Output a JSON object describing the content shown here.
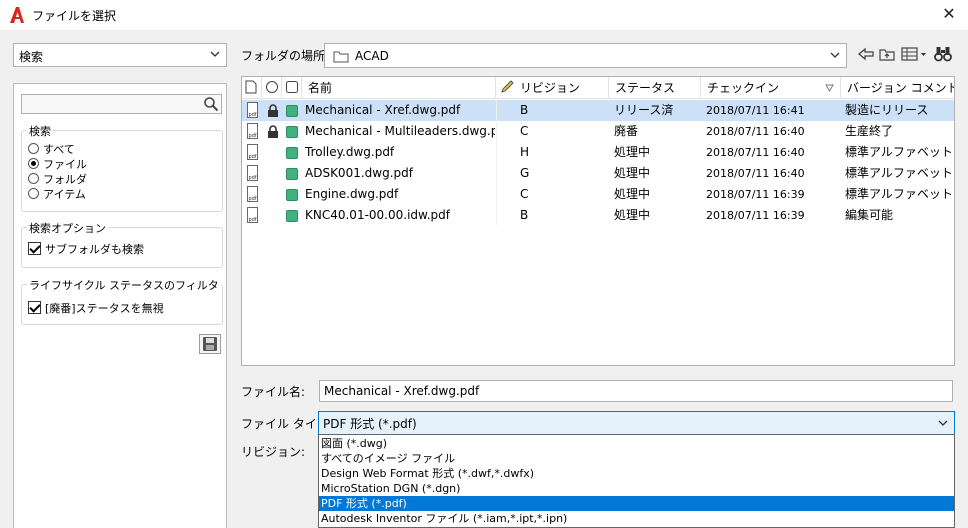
{
  "window": {
    "title": "ファイルを選択",
    "close_glyph": "✕"
  },
  "left": {
    "search_mode": "検索",
    "search_group_label": "検索",
    "radio_options": [
      {
        "label": "すべて",
        "selected": false
      },
      {
        "label": "ファイル",
        "selected": true
      },
      {
        "label": "フォルダ",
        "selected": false
      },
      {
        "label": "アイテム",
        "selected": false
      }
    ],
    "options_group_label": "検索オプション",
    "subfolder_label": "サブフォルダも検索",
    "subfolder_checked": true,
    "lifecycle_group_label": "ライフサイクル ステータスのフィルタ",
    "ignore_obsolete_label": "[廃番]ステータスを無視",
    "ignore_obsolete_checked": true
  },
  "folder": {
    "label": "フォルダの場所:",
    "value": "ACAD"
  },
  "table": {
    "headers": {
      "name": "名前",
      "revision": "リビジョン",
      "status": "ステータス",
      "checkin": "チェックイン",
      "version_comment": "バージョン コメント"
    },
    "rows": [
      {
        "name": "Mechanical - Xref.dwg.pdf",
        "revision": "B",
        "status": "リリース済",
        "checkin": "2018/07/11 16:41",
        "comment": "製造にリリース",
        "locked": true,
        "selected": true
      },
      {
        "name": "Mechanical - Multileaders.dwg.pdf",
        "revision": "C",
        "status": "廃番",
        "checkin": "2018/07/11 16:40",
        "comment": "生産終了",
        "locked": true,
        "selected": false
      },
      {
        "name": "Trolley.dwg.pdf",
        "revision": "H",
        "status": "処理中",
        "checkin": "2018/07/11 16:40",
        "comment": "標準アルファベット フ...",
        "locked": false,
        "selected": false
      },
      {
        "name": "ADSK001.dwg.pdf",
        "revision": "G",
        "status": "処理中",
        "checkin": "2018/07/11 16:40",
        "comment": "標準アルファベット フ...",
        "locked": false,
        "selected": false
      },
      {
        "name": "Engine.dwg.pdf",
        "revision": "C",
        "status": "処理中",
        "checkin": "2018/07/11 16:39",
        "comment": "標準アルファベット フ...",
        "locked": false,
        "selected": false
      },
      {
        "name": "KNC40.01-00.00.idw.pdf",
        "revision": "B",
        "status": "処理中",
        "checkin": "2018/07/11 16:39",
        "comment": "編集可能",
        "locked": false,
        "selected": false
      }
    ]
  },
  "bottom": {
    "filename_label": "ファイル名:",
    "filename_value": "Mechanical - Xref.dwg.pdf",
    "filetype_label": "ファイル タイプ:",
    "filetype_value": "PDF 形式 (*.pdf)",
    "revision_label": "リビジョン:",
    "filetype_options": [
      "図面 (*.dwg)",
      "すべてのイメージ ファイル",
      "Design Web Format 形式 (*.dwf,*.dwfx)",
      "MicroStation DGN (*.dgn)",
      "PDF 形式 (*.pdf)",
      "Autodesk Inventor ファイル (*.iam,*.ipt,*.ipn)"
    ],
    "filetype_selected_index": 4
  },
  "colors": {
    "accent": "#0078d7",
    "selection_row": "#cce0f7",
    "status_green": "#3fb27f",
    "app_red": "#d9261c"
  }
}
